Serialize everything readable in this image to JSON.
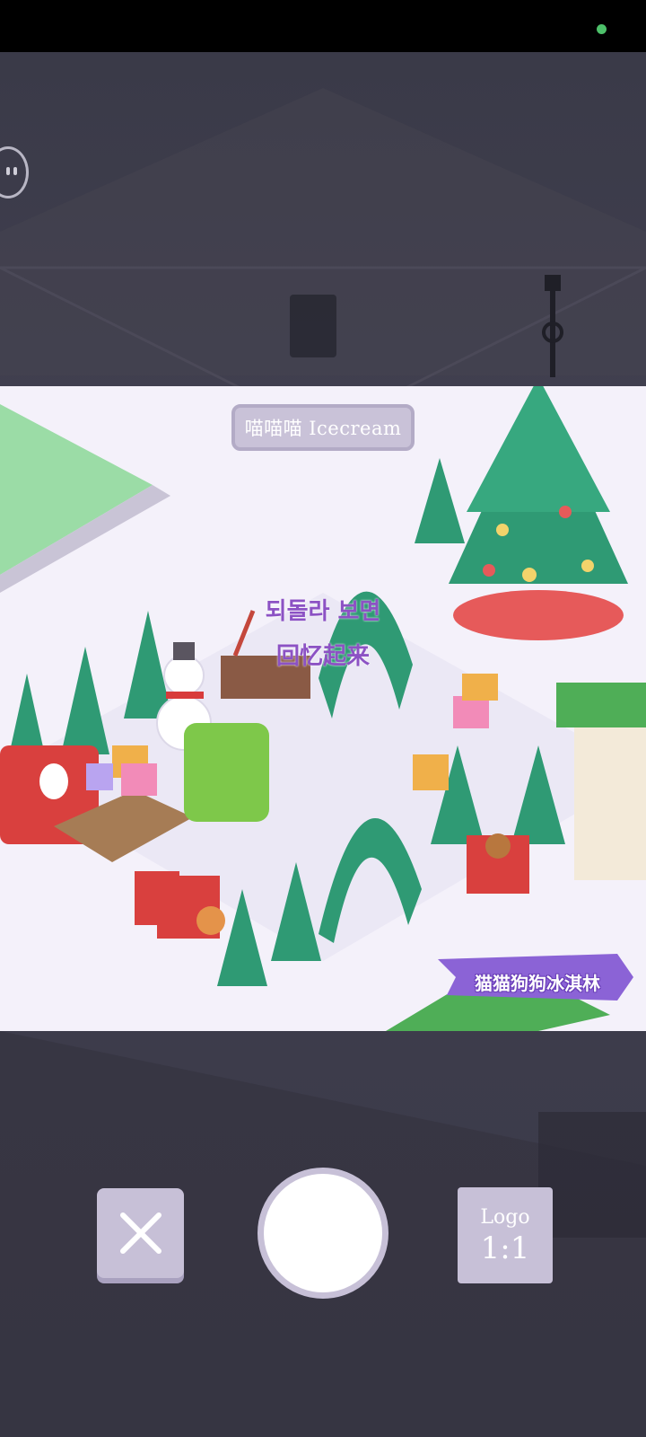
{
  "status_bar": {
    "indicator_color": "#4dc06a"
  },
  "scene": {
    "shop_sign": "喵喵喵 Icecream",
    "overlay_text_line1": "되돌라 보면",
    "overlay_text_line2": "回忆起来",
    "brand_ribbon": "猫猫狗狗冰淇林"
  },
  "controls": {
    "close_icon": "close-icon",
    "shutter": "shutter-button",
    "ratio_logo_label": "Logo",
    "ratio_value": "1:1"
  },
  "colors": {
    "accent": "#c7c0d7",
    "overlay_text": "#8c52c4",
    "background_dim": "#3a3a48"
  }
}
